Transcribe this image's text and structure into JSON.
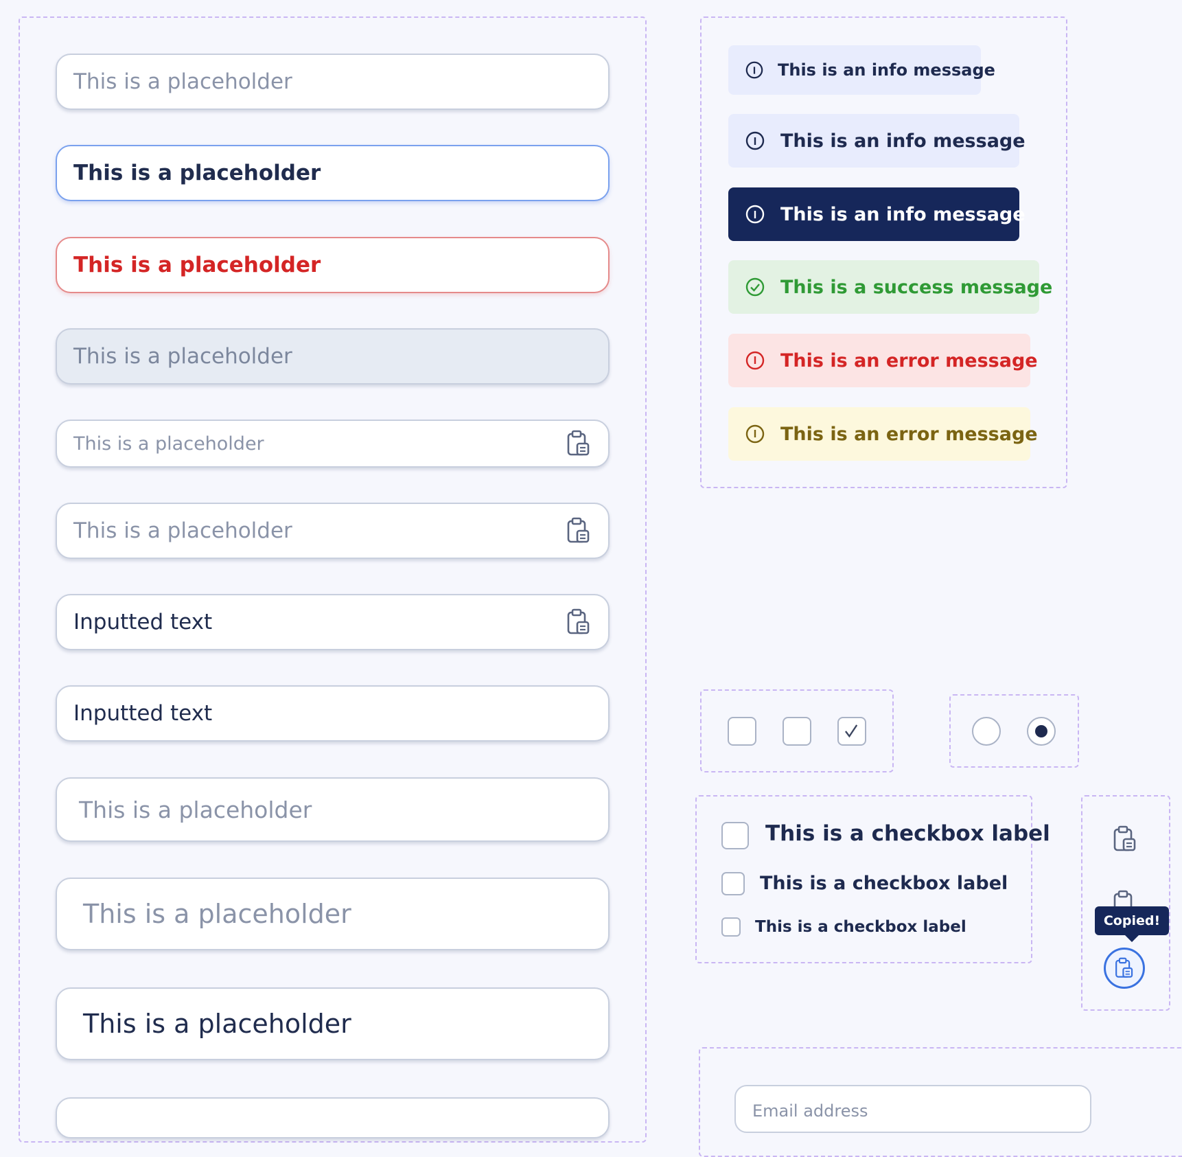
{
  "inputs": [
    {
      "text": "This is a placeholder",
      "state": "placeholder"
    },
    {
      "text": "This is a placeholder",
      "state": "focused"
    },
    {
      "text": "This is a placeholder",
      "state": "error"
    },
    {
      "text": "This is a placeholder",
      "state": "disabled"
    },
    {
      "text": "This is a placeholder",
      "state": "placeholder",
      "icon": "clipboard-icon"
    },
    {
      "text": "This is a placeholder",
      "state": "placeholder",
      "icon": "clipboard-icon"
    },
    {
      "text": "Inputted text",
      "state": "filled",
      "icon": "clipboard-icon"
    },
    {
      "text": "Inputted text",
      "state": "filled"
    },
    {
      "text": "This is a placeholder",
      "state": "placeholder"
    },
    {
      "text": "This is a placeholder",
      "state": "placeholder"
    },
    {
      "text": "This is a placeholder",
      "state": "filled"
    }
  ],
  "messages": [
    {
      "text": "This is an info message",
      "kind": "info",
      "icon": "info-icon"
    },
    {
      "text": "This is an info message",
      "kind": "info",
      "icon": "info-icon"
    },
    {
      "text": "This is an info message",
      "kind": "info-dark",
      "icon": "info-icon"
    },
    {
      "text": "This is a success message",
      "kind": "success",
      "icon": "check-circle-icon"
    },
    {
      "text": "This is an error message",
      "kind": "error",
      "icon": "error-icon"
    },
    {
      "text": "This is an error message",
      "kind": "warning",
      "icon": "error-icon"
    }
  ],
  "checkboxes": [
    {
      "checked": false
    },
    {
      "checked": false
    },
    {
      "checked": true
    }
  ],
  "radios": [
    {
      "selected": false
    },
    {
      "selected": true
    }
  ],
  "checkbox_labels": [
    {
      "label": "This is a checkbox label"
    },
    {
      "label": "This is a checkbox label"
    },
    {
      "label": "This is a checkbox label"
    }
  ],
  "copy": {
    "tooltip": "Copied!"
  },
  "email": {
    "placeholder": "Email address"
  },
  "colors": {
    "page_bg": "#f6f7fd",
    "dashed_border": "#c9b6f3",
    "info_bg": "#e8ecfd",
    "info_dark_bg": "#16275a",
    "success_bg": "#e3f2e3",
    "success_text": "#2f9a35",
    "error_bg": "#fce4e4",
    "error_text": "#d42525",
    "warning_bg": "#fdf8dd",
    "warning_text": "#7b6412",
    "focus_border": "#7aa1ee",
    "copy_accent": "#3a72e0"
  }
}
